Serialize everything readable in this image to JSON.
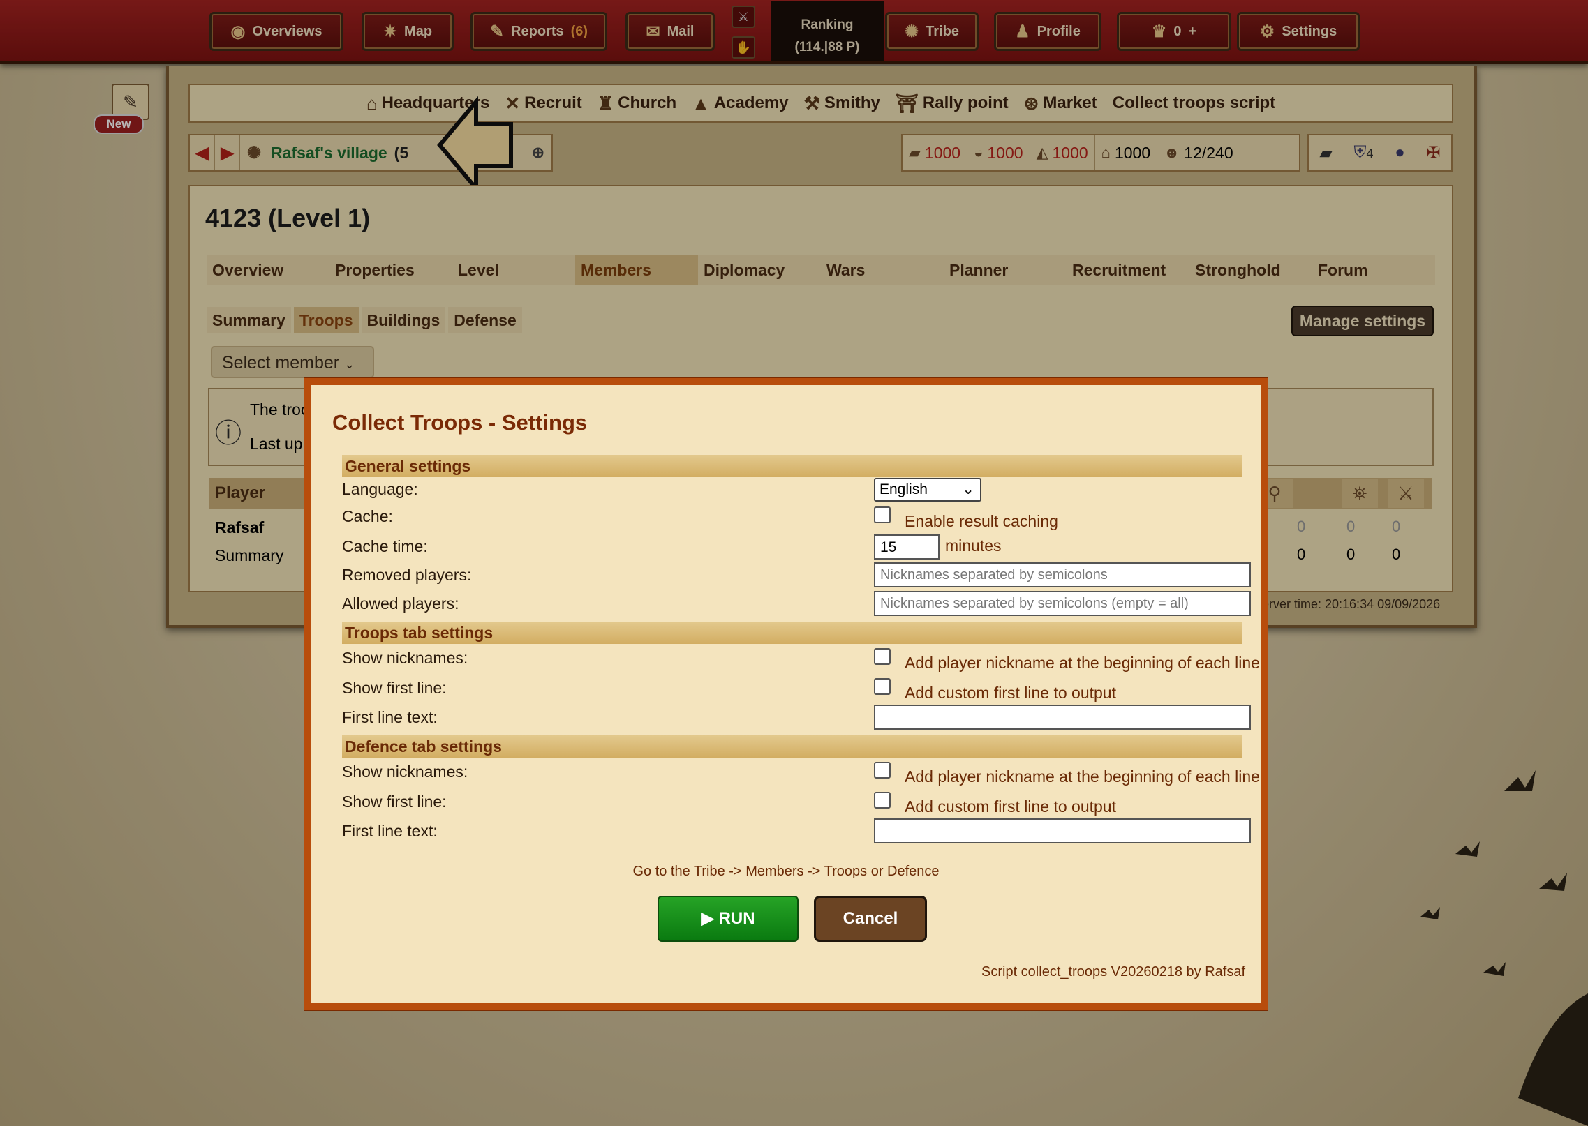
{
  "topbar": {
    "overviews": "Overviews",
    "map": "Map",
    "reports_label": "Reports",
    "reports_count": "(6)",
    "mail": "Mail",
    "ranking_label": "Ranking",
    "ranking_value": "(114.|88 P)",
    "tribe": "Tribe",
    "profile": "Profile",
    "premium_count": "0",
    "premium_plus": "+",
    "settings": "Settings"
  },
  "new_badge": "New",
  "buildings": [
    {
      "label": "Headquarters",
      "icon": "headquarters-icon"
    },
    {
      "label": "Recruit",
      "icon": "recruit-icon"
    },
    {
      "label": "Church",
      "icon": "church-icon"
    },
    {
      "label": "Academy",
      "icon": "academy-icon"
    },
    {
      "label": "Smithy",
      "icon": "smithy-icon"
    },
    {
      "label": "Rally point",
      "icon": "rally-point-icon"
    },
    {
      "label": "Market",
      "icon": "market-icon"
    },
    {
      "label": "Collect troops script",
      "icon": ""
    }
  ],
  "village": {
    "name": "Rafsaf's village",
    "coord": "(5"
  },
  "resources": {
    "wood": "1000",
    "clay": "1000",
    "iron": "1000",
    "food": "1000",
    "population": "12/240",
    "unit_count": "4"
  },
  "tribe": {
    "title": "4123 (Level 1)"
  },
  "tabs": [
    "Overview",
    "Properties",
    "Level",
    "Members",
    "Diplomacy",
    "Wars",
    "Planner",
    "Recruitment",
    "Stronghold",
    "Forum"
  ],
  "subtabs": [
    "Summary",
    "Troops",
    "Buildings",
    "Defense"
  ],
  "manage_settings": "Manage settings",
  "select_member": "Select member",
  "info": {
    "line1": "The troo",
    "line2": "Last up"
  },
  "table": {
    "header_player": "Player",
    "row1_name": "Rafsaf",
    "row2_name": "Summary",
    "row1_values": [
      "0",
      "0",
      "0"
    ],
    "row2_values": [
      "0",
      "0",
      "0"
    ]
  },
  "server_time": "erver time: 20:16:34 09/09/2026",
  "modal": {
    "title": "Collect Troops - Settings",
    "general_header": "General settings",
    "language_label": "Language:",
    "language_value": "English",
    "cache_label": "Cache:",
    "cache_checkbox": "Enable result caching",
    "cache_time_label": "Cache time:",
    "cache_time_value": "15",
    "minutes": "minutes",
    "removed_label": "Removed players:",
    "removed_placeholder": "Nicknames separated by semicolons",
    "allowed_label": "Allowed players:",
    "allowed_placeholder": "Nicknames separated by semicolons (empty = all)",
    "troops_header": "Troops tab settings",
    "defence_header": "Defence tab settings",
    "show_nicknames_label": "Show nicknames:",
    "show_nicknames_text": "Add player nickname at the beginning of each line",
    "show_first_line_label": "Show first line:",
    "show_first_line_text": "Add custom first line to output",
    "first_line_text_label": "First line text:",
    "hint": "Go to the Tribe -> Members -> Troops or Defence",
    "run": "▶ RUN",
    "cancel": "Cancel",
    "credit": "Script collect_troops V20260218 by Rafsaf"
  },
  "colors": {
    "topbar": "#8f1a17",
    "modal_border": "#b84d0c",
    "run_green": "#1a9a1a",
    "section_gold": "#d8b46c"
  }
}
